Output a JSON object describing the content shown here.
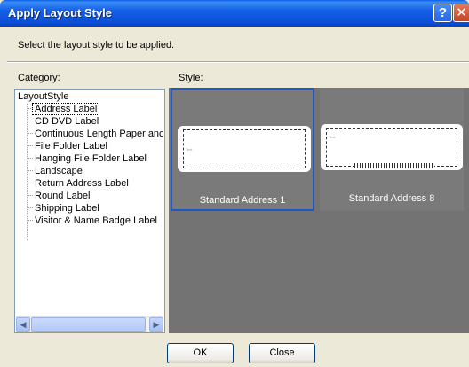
{
  "window": {
    "title": "Apply Layout Style",
    "help_glyph": "?",
    "close_glyph": "✕"
  },
  "instruction": "Select the layout style to be applied.",
  "category": {
    "label": "Category:",
    "root": "LayoutStyle",
    "items": [
      "Address Label",
      "CD DVD Label",
      "Continuous Length Paper anc",
      "File Folder Label",
      "Hanging File Folder Label",
      "Landscape",
      "Return Address Label",
      "Round Label",
      "Shipping Label",
      "Visitor & Name Badge Label"
    ],
    "selected": "Address Label"
  },
  "style": {
    "label": "Style:",
    "cards": [
      {
        "name": "Standard Address 1",
        "preview_text": "Text",
        "selected": true
      },
      {
        "name": "Standard Address 8",
        "preview_text": "Text",
        "selected": false
      }
    ]
  },
  "scroll": {
    "left_glyph": "◀",
    "right_glyph": "▶"
  },
  "buttons": {
    "ok": "OK",
    "close": "Close"
  },
  "colors": {
    "title_bar": "#0b4ed6",
    "selection": "#1c58c8",
    "style_background": "#737373",
    "dialog_background": "#ece9d8"
  }
}
